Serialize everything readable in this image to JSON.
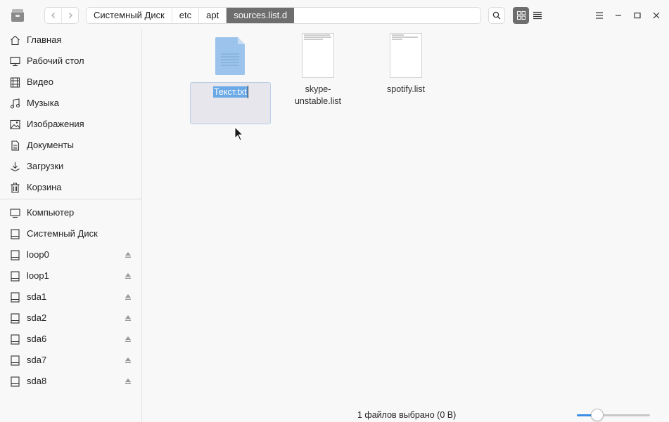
{
  "toolbar": {
    "back_icon": "chevron-left-icon",
    "forward_icon": "chevron-right-icon",
    "breadcrumbs": [
      "Системный Диск",
      "etc",
      "apt",
      "sources.list.d"
    ],
    "search_icon": "search-icon",
    "view_icon_grid": "grid-view-icon",
    "view_icon_list": "list-view-icon"
  },
  "sidebar": {
    "places": [
      {
        "label": "Главная",
        "icon": "home-icon"
      },
      {
        "label": "Рабочий стол",
        "icon": "desktop-icon"
      },
      {
        "label": "Видео",
        "icon": "video-icon"
      },
      {
        "label": "Музыка",
        "icon": "music-icon"
      },
      {
        "label": "Изображения",
        "icon": "image-icon"
      },
      {
        "label": "Документы",
        "icon": "document-icon"
      },
      {
        "label": "Загрузки",
        "icon": "download-icon"
      },
      {
        "label": "Корзина",
        "icon": "trash-icon"
      }
    ],
    "devices": [
      {
        "label": "Компьютер",
        "icon": "computer-icon",
        "eject": false
      },
      {
        "label": "Системный Диск",
        "icon": "drive-icon",
        "eject": false
      },
      {
        "label": "loop0",
        "icon": "drive-icon",
        "eject": true
      },
      {
        "label": "loop1",
        "icon": "drive-icon",
        "eject": true
      },
      {
        "label": "sda1",
        "icon": "drive-icon",
        "eject": true
      },
      {
        "label": "sda2",
        "icon": "drive-icon",
        "eject": true
      },
      {
        "label": "sda6",
        "icon": "drive-icon",
        "eject": true
      },
      {
        "label": "sda7",
        "icon": "drive-icon",
        "eject": true
      },
      {
        "label": "sda8",
        "icon": "drive-icon",
        "eject": true
      }
    ]
  },
  "files": [
    {
      "name": "Текст.txt",
      "icon": "text-file-icon",
      "selected": true,
      "renaming": true
    },
    {
      "name": "skype-\nunstable.list",
      "icon": "list-file-preview-icon",
      "selected": false
    },
    {
      "name": "spotify.list",
      "icon": "list-file-preview-icon",
      "selected": false
    }
  ],
  "status": {
    "text": "1 файлов выбрано (0 B)",
    "zoom_level": 0.28
  },
  "colors": {
    "accent": "#3a8ee6",
    "selection_bg": "#e6e6ec",
    "active_crumb": "#6e6e6e"
  }
}
